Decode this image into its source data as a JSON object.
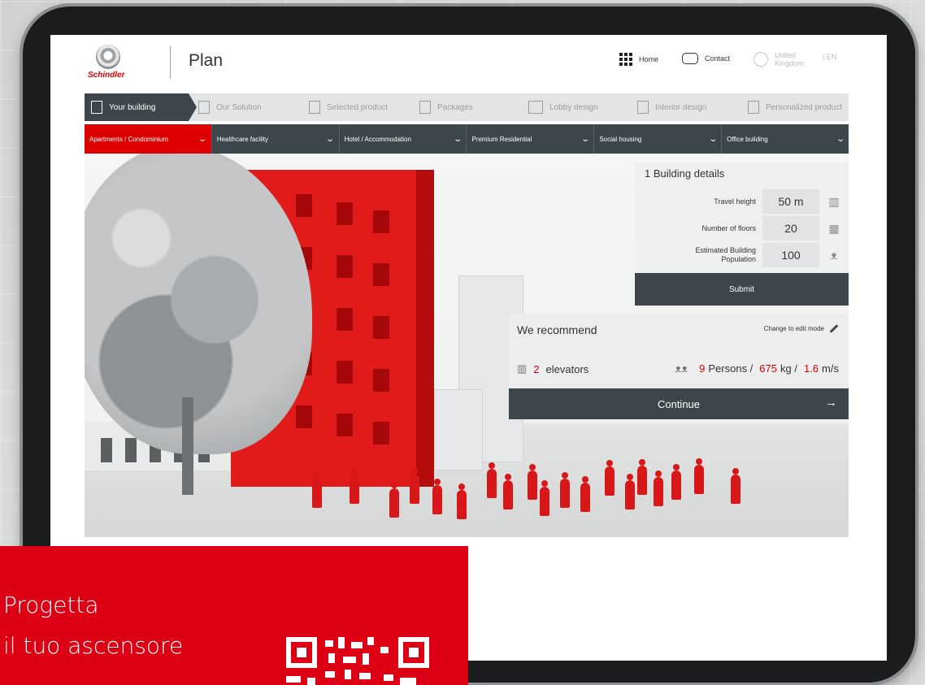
{
  "header": {
    "logo_text": "Schindler",
    "app_title": "Plan",
    "home_label": "Home",
    "contact_label": "Contact",
    "region_line1": "United",
    "region_line2": "Kingdom",
    "language": "| EN"
  },
  "steps": [
    {
      "label": "Your building",
      "icon": "building-icon"
    },
    {
      "label": "Our Solution",
      "icon": "elevator-icon"
    },
    {
      "label": "Selected product",
      "icon": "document-icon"
    },
    {
      "label": "Packages",
      "icon": "packages-icon"
    },
    {
      "label": "Lobby design",
      "icon": "frame-icon"
    },
    {
      "label": "Interior design",
      "icon": "interior-icon"
    },
    {
      "label": "Personalized product",
      "icon": "pencil-doc-icon"
    }
  ],
  "categories": [
    {
      "label": "Apartments / Condominium",
      "active": true
    },
    {
      "label": "Healthcare facility"
    },
    {
      "label": "Hotel / Accommodation"
    },
    {
      "label": "Premium Residential"
    },
    {
      "label": "Social housing"
    },
    {
      "label": "Office building"
    }
  ],
  "details": {
    "title": "1 Building details",
    "rows": [
      {
        "label": "Travel height",
        "value": "50 m"
      },
      {
        "label": "Number of floors",
        "value": "20"
      },
      {
        "label": "Estimated Building Population",
        "value": "100"
      }
    ],
    "submit_label": "Submit"
  },
  "recommendation": {
    "title": "We recommend",
    "edit_label": "Change to edit mode",
    "elevator_count": "2",
    "elevator_unit": "elevators",
    "persons": "9",
    "persons_unit": "Persons /",
    "load": "675",
    "load_unit": "kg /",
    "speed": "1.6",
    "speed_unit": "m/s",
    "continue_label": "Continue",
    "continue_arrow": "→"
  },
  "promo": {
    "line1": "Progetta",
    "line2": "il tuo ascensore"
  },
  "colors": {
    "brand_red": "#dc0000",
    "dark_slate": "#3c464b",
    "promo_red": "#dd0014"
  }
}
